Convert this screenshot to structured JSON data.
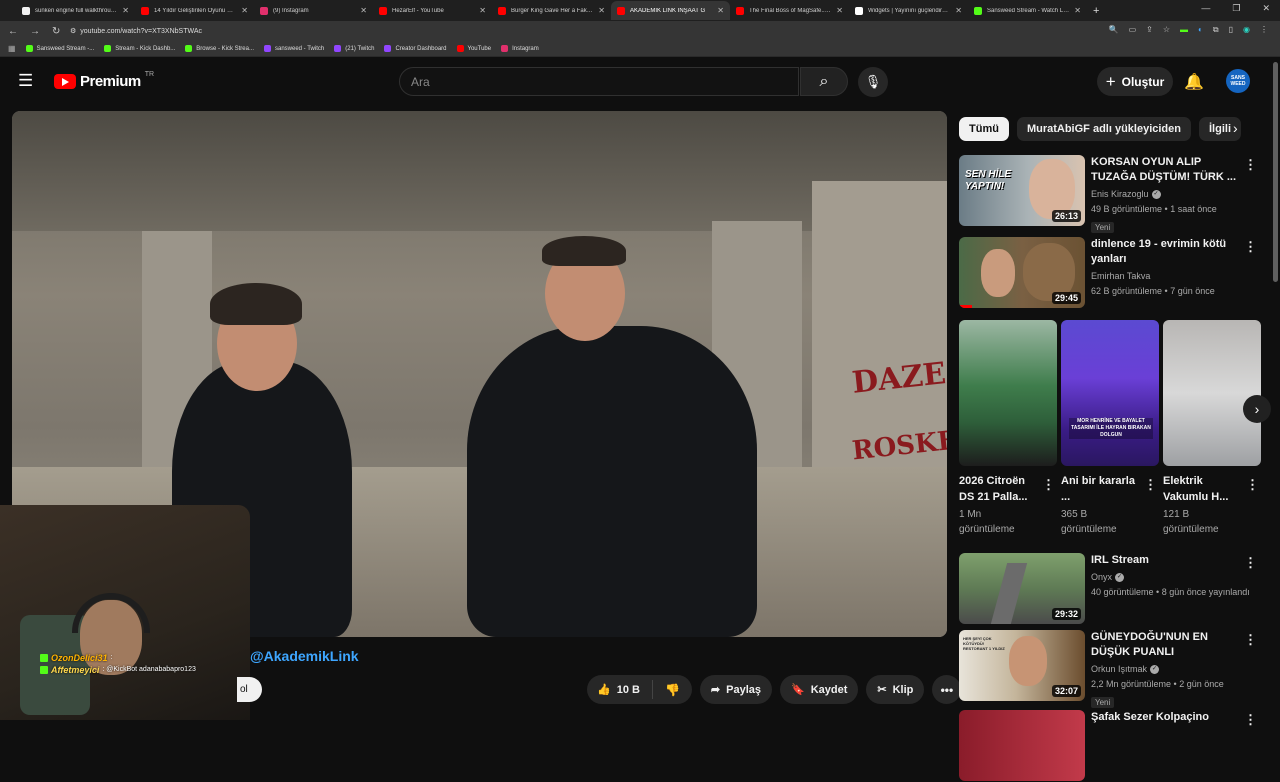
{
  "browser": {
    "tabs": [
      {
        "title": "sunken engine full walkthrough",
        "color": "#f1f1f1"
      },
      {
        "title": "14 Yıldır Geliştirilen Oyunu Oyn",
        "color": "#ff0000"
      },
      {
        "title": "(9) Instagram",
        "color": "#e1306c"
      },
      {
        "title": "HezarElf - YouTube",
        "color": "#ff0000"
      },
      {
        "title": "Burger King Gave Her a Fake B",
        "color": "#ff0000"
      },
      {
        "title": "AKADEMİK LİNK İNŞAAT G",
        "color": "#ff0000",
        "active": true
      },
      {
        "title": "The Final Boss of MagSafe... #",
        "color": "#ff0000"
      },
      {
        "title": "Widgets | Yayınını güçlendirme",
        "color": "#ffffff"
      },
      {
        "title": "Sansweed Stream - Watch Live o",
        "color": "#53fc18"
      }
    ],
    "new_tab": "+",
    "url": "youtube.com/watch?v=XT3XNbSTWAc",
    "bookmarks": [
      {
        "label": "Sansweed Stream -...",
        "color": "#53fc18"
      },
      {
        "label": "Stream - Kick Dashb...",
        "color": "#53fc18"
      },
      {
        "label": "Browse - Kick Strea...",
        "color": "#53fc18"
      },
      {
        "label": "sansweed - Twitch",
        "color": "#9146ff"
      },
      {
        "label": "(21) Twitch",
        "color": "#9146ff"
      },
      {
        "label": "Creator Dashboard",
        "color": "#9146ff"
      },
      {
        "label": "YouTube",
        "color": "#ff0000"
      },
      {
        "label": "Instagram",
        "color": "#e1306c"
      }
    ]
  },
  "header": {
    "logo_text": "Premium",
    "country": "TR",
    "search_placeholder": "Ara",
    "create_label": "Oluştur",
    "avatar_text": "SANS WEED"
  },
  "video": {
    "channel_mention": "@AkademikLink",
    "sub_fragment": "ol",
    "likes": "10 B",
    "share_label": "Paylaş",
    "save_label": "Kaydet",
    "clip_label": "Klip",
    "graffiti": [
      "DAZE",
      "ROSKE"
    ]
  },
  "overlay_chat": [
    {
      "user": "OzonDelici31",
      "message": ":"
    },
    {
      "user": "Affetmeyici",
      "message": ": @KickBot adanababapro123"
    }
  ],
  "chips": [
    {
      "label": "Tümü",
      "active": true
    },
    {
      "label": "MuratAbiGF adlı yükleyiciden",
      "active": false
    },
    {
      "label": "İlgili",
      "active": false
    }
  ],
  "recommended": [
    {
      "title": "KORSAN OYUN ALIP TUZAĞA DÜŞTÜM! TÜRK ...",
      "channel": "Enis Kirazoglu",
      "verified": true,
      "meta": "49 B görüntüleme • 1 saat önce",
      "badge": "Yeni",
      "duration": "26:13",
      "thumb_text": "SEN HİLE YAPTIN!",
      "watched": 0
    },
    {
      "title": "dinlence 19 - evrimin kötü yanları",
      "channel": "Emirhan Takva",
      "verified": false,
      "meta": "62 B görüntüleme • 7 gün önce",
      "badge": "",
      "duration": "29:45",
      "thumb_text": "",
      "watched": 0.1
    }
  ],
  "shorts": [
    {
      "title": "2026 Citroën DS 21 Palla...",
      "views": "1 Mn",
      "views_label": "görüntüleme"
    },
    {
      "title": "Ani bir kararla ...",
      "views": "365 B",
      "views_label": "görüntüleme",
      "overlay": "MOR HENRİNE VE BAYALET TASARIMI İLE HAYRAN BIRAKAN DOLGUN"
    },
    {
      "title": "Elektrik Vakumlu H...",
      "views": "121 B",
      "views_label": "görüntüleme"
    }
  ],
  "recommended_more": [
    {
      "title": "IRL Stream",
      "channel": "Onyx",
      "verified": true,
      "meta": "40 görüntüleme • 8 gün önce yayınlandı",
      "badge": "",
      "duration": "29:32"
    },
    {
      "title": "GÜNEYDOĞU'NUN EN DÜŞÜK PUANLI RESTORANTLARI!",
      "channel": "Orkun Işıtmak",
      "verified": true,
      "meta": "2,2 Mn görüntüleme • 2 gün önce",
      "badge": "Yeni",
      "duration": "32:07",
      "thumb_text": "HER ŞEYİ ÇOK KÖTÜYDÜ! RESTORANT 1 YILDIZ"
    },
    {
      "title": "Şafak Sezer Kolpaçino",
      "channel": "",
      "verified": false,
      "meta": "",
      "badge": "",
      "duration": ""
    }
  ]
}
